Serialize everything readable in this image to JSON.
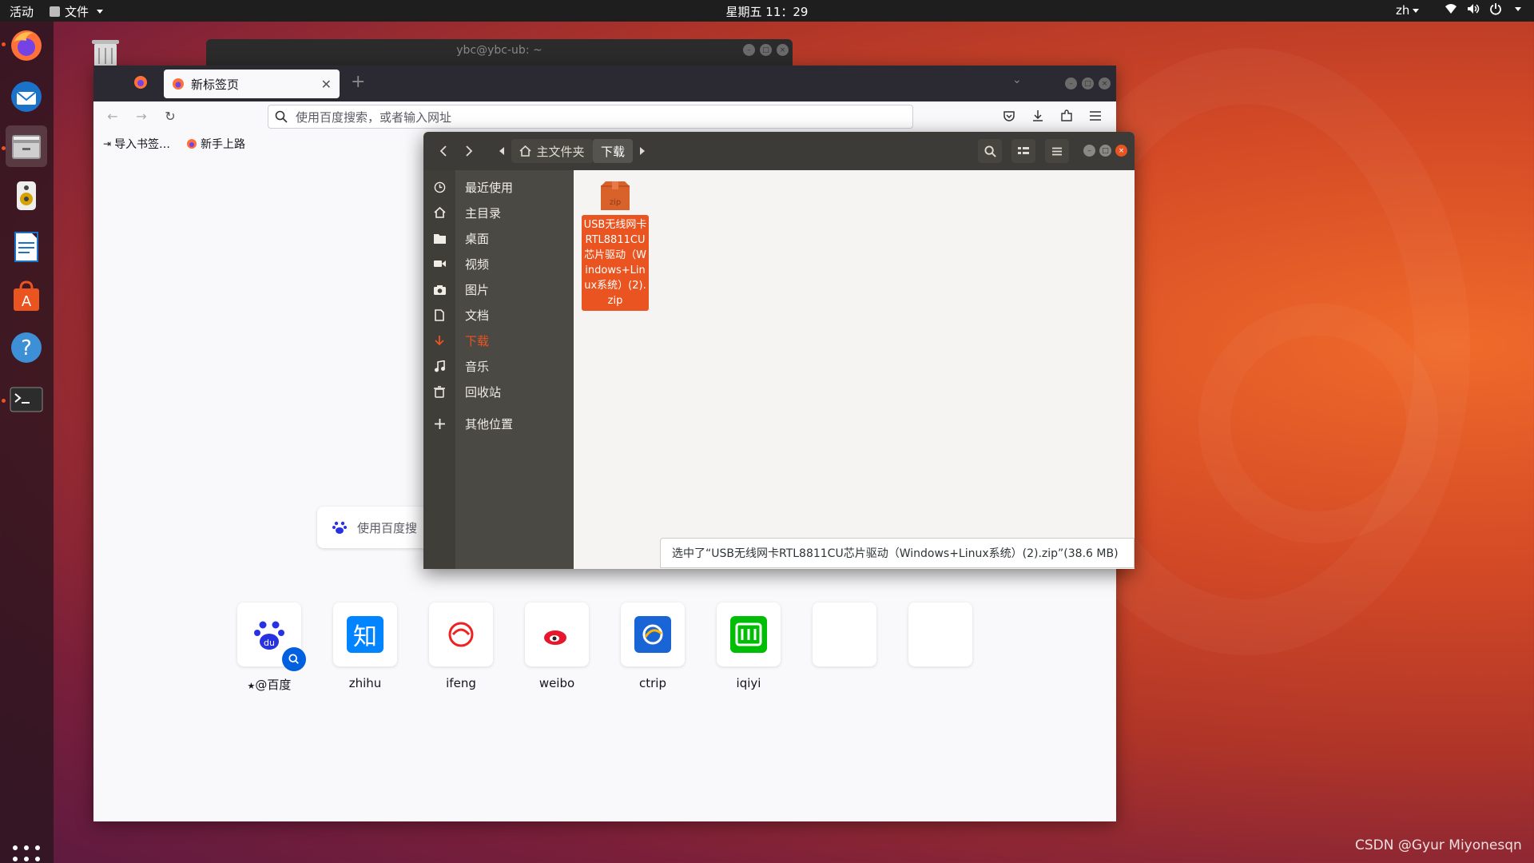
{
  "topbar": {
    "activities": "活动",
    "app_menu": "文件",
    "clock": "星期五 11：29",
    "lang": "zh"
  },
  "terminal": {
    "title": "ybc@ybc-ub: ~"
  },
  "firefox": {
    "tab_title": "新标签页",
    "url_placeholder": "使用百度搜索，或者输入网址",
    "bookmarks": [
      "导入书签…",
      "新手上路"
    ],
    "search_placeholder": "使用百度搜",
    "top_sites": [
      {
        "label": "@百度",
        "icon": "baidu-icon"
      },
      {
        "label": "zhihu",
        "icon": "zhihu-icon",
        "glyph": "知"
      },
      {
        "label": "ifeng",
        "icon": "ifeng-icon"
      },
      {
        "label": "weibo",
        "icon": "weibo-icon"
      },
      {
        "label": "ctrip",
        "icon": "ctrip-icon"
      },
      {
        "label": "iqiyi",
        "icon": "iqiyi-icon"
      }
    ]
  },
  "files": {
    "breadcrumb_home": "主文件夹",
    "breadcrumb_current": "下载",
    "sidebar": [
      {
        "label": "最近使用",
        "icon": "clock-icon"
      },
      {
        "label": "主目录",
        "icon": "home-icon"
      },
      {
        "label": "桌面",
        "icon": "folder-icon"
      },
      {
        "label": "视频",
        "icon": "video-icon"
      },
      {
        "label": "图片",
        "icon": "camera-icon"
      },
      {
        "label": "文档",
        "icon": "document-icon"
      },
      {
        "label": "下载",
        "icon": "download-icon",
        "selected": true
      },
      {
        "label": "音乐",
        "icon": "music-icon"
      },
      {
        "label": "回收站",
        "icon": "trash-icon"
      },
      {
        "label": "其他位置",
        "icon": "plus-icon"
      }
    ],
    "file": {
      "ext": "zip",
      "name": "USB无线网卡RTL8811CU芯片驱动（Windows+Linux系统）(2).zip"
    },
    "status": "选中了“USB无线网卡RTL8811CU芯片驱动（Windows+Linux系统）(2).zip”(38.6 MB)"
  },
  "watermark": "CSDN @Gyur Miyonesqn",
  "colors": {
    "accent": "#e95420",
    "topbar": "#1e1e1e",
    "files_header": "#3c3b37"
  }
}
